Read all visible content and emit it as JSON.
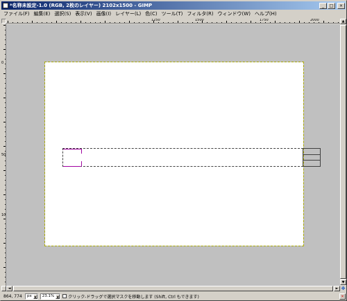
{
  "window": {
    "title": "*名称未設定-1.0 (RGB, 2枚のレイヤー) 2102x1500 - GIMP",
    "min_glyph": "_",
    "max_glyph": "□",
    "close_glyph": "×"
  },
  "menubar": {
    "items": [
      {
        "label": "ファイル(F)"
      },
      {
        "label": "編集(E)"
      },
      {
        "label": "選択(S)"
      },
      {
        "label": "表示(V)"
      },
      {
        "label": "画像(I)"
      },
      {
        "label": "レイヤー(L)"
      },
      {
        "label": "色(C)"
      },
      {
        "label": "ツール(T)"
      },
      {
        "label": "フィルタ(R)"
      },
      {
        "label": "ウィンドウ(W)"
      },
      {
        "label": "ヘルプ(H)"
      }
    ]
  },
  "hruler": {
    "labels": [
      "1250",
      "1500",
      "1750",
      "2000"
    ]
  },
  "vruler": {
    "labels": [
      "0",
      "500",
      "1000"
    ]
  },
  "statusbar": {
    "coords": "864, 774",
    "unit": "px",
    "zoom": "23.1%",
    "message": "クリック-ドラッグで選択マスクを移動します (Shift, Ctrl もできます)",
    "cancel_glyph": "×"
  },
  "icons": {
    "navigate": "navigate-icon",
    "quick_mask": "quick-mask-icon"
  },
  "colors": {
    "titlebar_start": "#0a246a",
    "titlebar_end": "#a6caf0",
    "canvas_bg": "#c0c0c0",
    "layer_boundary": "#aaaa00",
    "active_layer_edge": "#a000a0"
  }
}
